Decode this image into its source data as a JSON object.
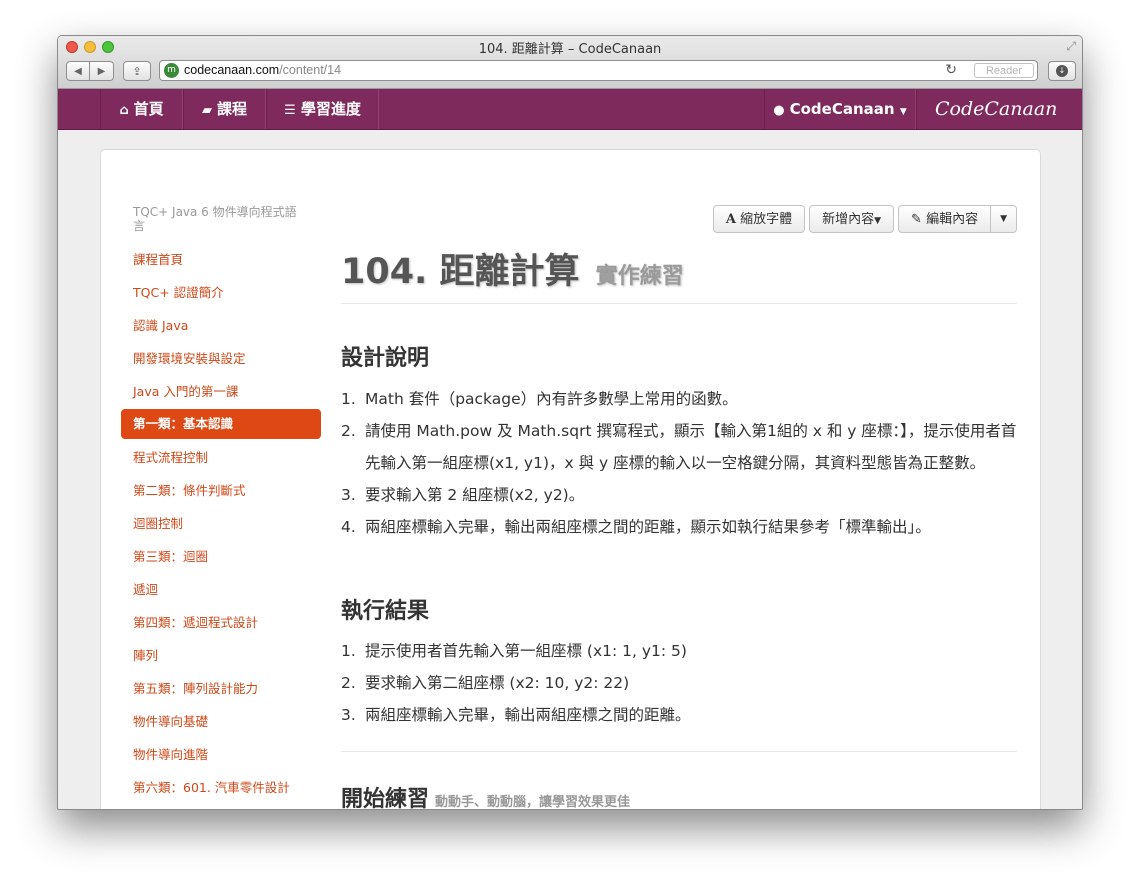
{
  "window": {
    "title": "104. 距離計算 – CodeCanaan"
  },
  "browser": {
    "url_host": "codecanaan.com",
    "url_path": "/content/14",
    "reader_label": "Reader",
    "favicon_letter": "m"
  },
  "sitenav": {
    "home": "首頁",
    "courses": "課程",
    "progress": "學習進度",
    "user": "CodeCanaan",
    "brand": "CodeCanaan"
  },
  "sidebar": {
    "header": "TQC+ Java 6 物件導向程式語言",
    "items": [
      {
        "label": "課程首頁"
      },
      {
        "label": "TQC+ 認證簡介"
      },
      {
        "label": "認識 Java"
      },
      {
        "label": "開發環境安裝與設定"
      },
      {
        "label": "Java 入門的第一課"
      },
      {
        "label": "第一類：基本認識"
      },
      {
        "label": "程式流程控制"
      },
      {
        "label": "第二類：條件判斷式"
      },
      {
        "label": "迴圈控制"
      },
      {
        "label": "第三類：迴圈"
      },
      {
        "label": "遞迴"
      },
      {
        "label": "第四類：遞迴程式設計"
      },
      {
        "label": "陣列"
      },
      {
        "label": "第五類：陣列設計能力"
      },
      {
        "label": "物件導向基礎"
      },
      {
        "label": "物件導向進階"
      },
      {
        "label": "第六類：601. 汽車零件設計"
      }
    ]
  },
  "toolbar": {
    "zoom_font": "縮放字體",
    "add_content": "新增內容",
    "edit_content": "編輯內容"
  },
  "page": {
    "title": "104. 距離計算",
    "subtitle": "實作練習",
    "design_heading": "設計說明",
    "design_items": [
      "Math 套件（package）內有許多數學上常用的函數。",
      "請使用 Math.pow 及 Math.sqrt 撰寫程式，顯示【輸入第1組的 x 和 y 座標：】，提示使用者首先輸入第一組座標(x1, y1)，x 與 y 座標的輸入以一空格鍵分隔，其資料型態皆為正整數。",
      "要求輸入第 2 組座標(x2, y2)。",
      "兩組座標輸入完畢，輸出兩組座標之間的距離，顯示如執行結果參考「標準輸出」。"
    ],
    "result_heading": "執行結果",
    "result_items": [
      "提示使用者首先輸入第一組座標 (x1: 1, y1: 5)",
      "要求輸入第二組座標 (x2: 10, y2: 22)",
      "兩組座標輸入完畢，輸出兩組座標之間的距離。"
    ],
    "practice_heading": "開始練習",
    "practice_sub": "動動手、動動腦，讓學習效果更佳"
  },
  "colors": {
    "nav_bg": "#7f2a5c",
    "accent": "#dd4814",
    "link": "#d04818"
  }
}
